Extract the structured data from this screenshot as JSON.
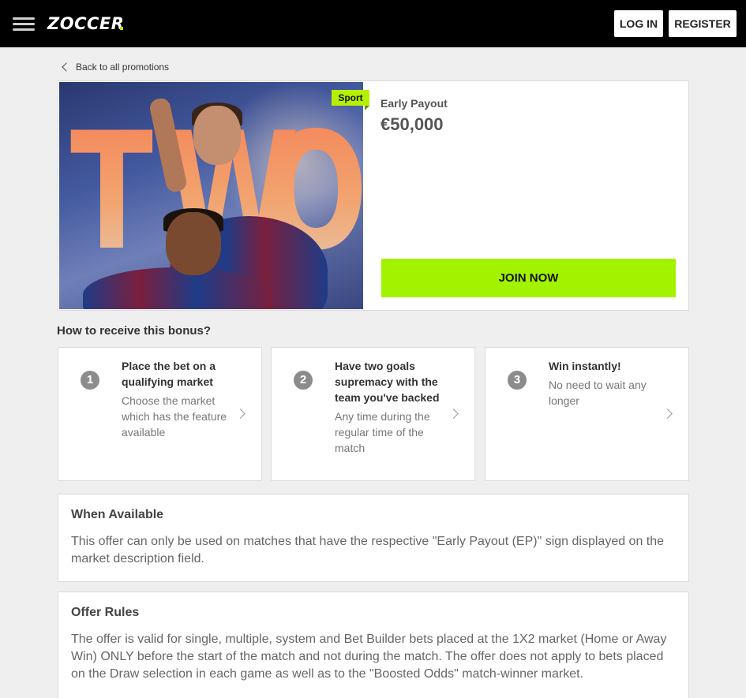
{
  "header": {
    "logo": "ZOCCER",
    "login_label": "LOG IN",
    "register_label": "REGISTER"
  },
  "back_link": "Back to all promotions",
  "promo": {
    "image_text": [
      "T",
      "W",
      "O"
    ],
    "badge": "Sport",
    "type": "Early Payout",
    "amount": "€50,000",
    "join_label": "JOIN NOW"
  },
  "how_to": {
    "title": "How to receive this bonus?",
    "steps": [
      {
        "number": "1",
        "title": "Place the bet on a qualifying market",
        "desc": "Choose the market which has the feature available"
      },
      {
        "number": "2",
        "title": "Have two goals supremacy with the team you've backed",
        "desc": "Any time during the regular time of the match"
      },
      {
        "number": "3",
        "title": "Win instantly!",
        "desc": "No need to wait any longer"
      }
    ]
  },
  "when_available": {
    "title": "When Available",
    "text": "This offer can only be used on matches that have the respective \"Early Payout (EP)\" sign displayed on the market description field."
  },
  "offer_rules": {
    "title": "Offer Rules",
    "text": "The offer is valid for single, multiple, system and Bet Builder bets placed at the 1X2 market (Home or Away Win) ONLY before the start of the match and not during the match. The offer does not apply to bets placed on the Draw selection in each game as well as to the \"Boosted Odds\" match-winner market."
  },
  "colors": {
    "accent": "#a3f200",
    "header_bg": "#000000",
    "page_bg": "#efefef"
  }
}
